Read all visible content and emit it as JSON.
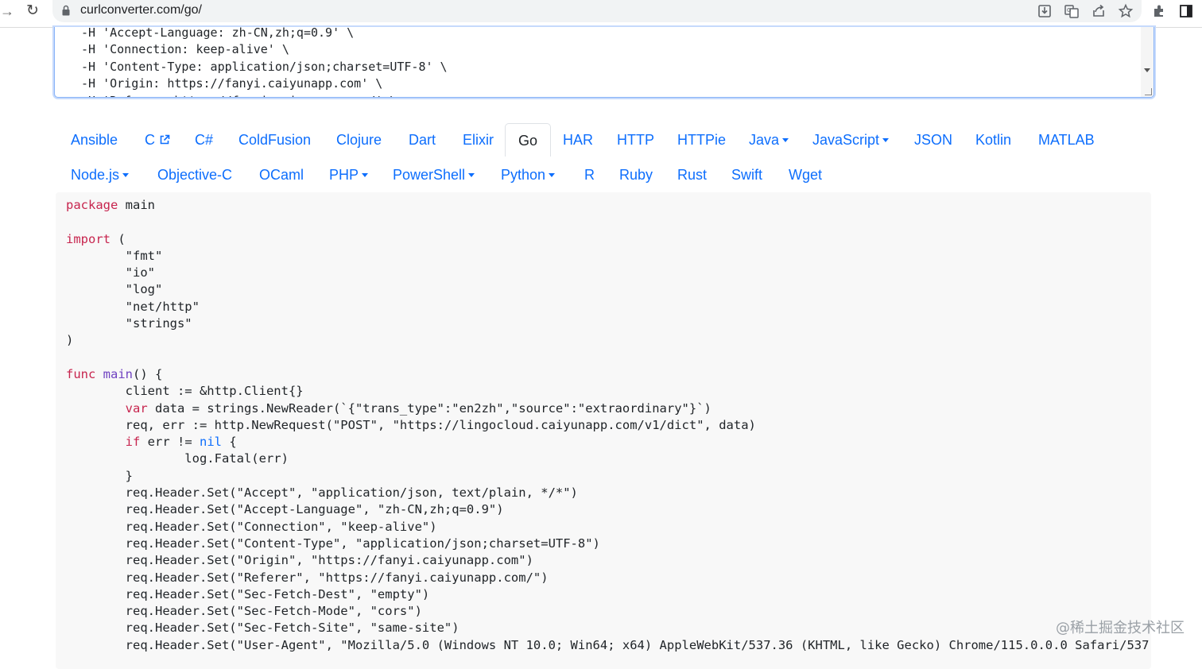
{
  "browser": {
    "url": "curlconverter.com/go/",
    "toolbar_icons": [
      "forward-icon",
      "reload-icon",
      "lock-icon",
      "install-icon",
      "translate-icon",
      "share-icon",
      "bookmark-star-icon",
      "extensions-icon",
      "side-panel-icon"
    ]
  },
  "curl_input": {
    "lines": [
      "-H 'Accept-Language: zh-CN,zh;q=0.9' \\",
      "-H 'Connection: keep-alive' \\",
      "-H 'Content-Type: application/json;charset=UTF-8' \\",
      "-H 'Origin: https://fanyi.caiyunapp.com' \\",
      "-H 'Referer: https://fanyi.caiyunapp.com/' \\"
    ]
  },
  "languages": {
    "row1": [
      {
        "label": "Ansible"
      },
      {
        "label": "C",
        "external": true
      },
      {
        "label": "C#"
      },
      {
        "label": "ColdFusion"
      },
      {
        "label": "Clojure"
      },
      {
        "label": "Dart"
      },
      {
        "label": "Elixir"
      },
      {
        "label": "Go",
        "active": true
      },
      {
        "label": "HAR"
      },
      {
        "label": "HTTP"
      },
      {
        "label": "HTTPie"
      },
      {
        "label": "Java",
        "dropdown": true
      },
      {
        "label": "JavaScript",
        "dropdown": true
      },
      {
        "label": "JSON"
      },
      {
        "label": "Kotlin"
      },
      {
        "label": "MATLAB"
      }
    ],
    "row2": [
      {
        "label": "Node.js",
        "dropdown": true
      },
      {
        "label": "Objective-C"
      },
      {
        "label": "OCaml"
      },
      {
        "label": "PHP",
        "dropdown": true
      },
      {
        "label": "PowerShell",
        "dropdown": true
      },
      {
        "label": "Python",
        "dropdown": true
      },
      {
        "label": "R"
      },
      {
        "label": "Ruby"
      },
      {
        "label": "Rust"
      },
      {
        "label": "Swift"
      },
      {
        "label": "Wget"
      }
    ]
  },
  "code_output": {
    "lines": [
      [
        [
          "kw",
          "package"
        ],
        [
          "",
          "main"
        ]
      ],
      [],
      [
        [
          "kw",
          "import"
        ],
        [
          "",
          " ("
        ]
      ],
      [
        [
          "",
          "        \"fmt\""
        ]
      ],
      [
        [
          "",
          "        \"io\""
        ]
      ],
      [
        [
          "",
          "        \"log\""
        ]
      ],
      [
        [
          "",
          "        \"net/http\""
        ]
      ],
      [
        [
          "",
          "        \"strings\""
        ]
      ],
      [
        [
          "",
          ")"
        ]
      ],
      [],
      [
        [
          "kw",
          "func"
        ],
        [
          "",
          " "
        ],
        [
          "fn",
          "main"
        ],
        [
          "",
          "() {"
        ]
      ],
      [
        [
          "",
          "        client := &http.Client{}"
        ]
      ],
      [
        [
          "",
          "        "
        ],
        [
          "kw",
          "var"
        ],
        [
          "",
          " data = strings.NewReader(`{\"trans_type\":\"en2zh\",\"source\":\"extraordinary\"}`)"
        ]
      ],
      [
        [
          "",
          "        req, err := http.NewRequest(\"POST\", \"https://lingocloud.caiyunapp.com/v1/dict\", data)"
        ]
      ],
      [
        [
          "",
          "        "
        ],
        [
          "kw",
          "if"
        ],
        [
          "",
          " err != "
        ],
        [
          "kwb",
          "nil"
        ],
        [
          "",
          " {"
        ]
      ],
      [
        [
          "",
          "                log.Fatal(err)"
        ]
      ],
      [
        [
          "",
          "        }"
        ]
      ],
      [
        [
          "",
          "        req.Header.Set(\"Accept\", \"application/json, text/plain, */*\")"
        ]
      ],
      [
        [
          "",
          "        req.Header.Set(\"Accept-Language\", \"zh-CN,zh;q=0.9\")"
        ]
      ],
      [
        [
          "",
          "        req.Header.Set(\"Connection\", \"keep-alive\")"
        ]
      ],
      [
        [
          "",
          "        req.Header.Set(\"Content-Type\", \"application/json;charset=UTF-8\")"
        ]
      ],
      [
        [
          "",
          "        req.Header.Set(\"Origin\", \"https://fanyi.caiyunapp.com\")"
        ]
      ],
      [
        [
          "",
          "        req.Header.Set(\"Referer\", \"https://fanyi.caiyunapp.com/\")"
        ]
      ],
      [
        [
          "",
          "        req.Header.Set(\"Sec-Fetch-Dest\", \"empty\")"
        ]
      ],
      [
        [
          "",
          "        req.Header.Set(\"Sec-Fetch-Mode\", \"cors\")"
        ]
      ],
      [
        [
          "",
          "        req.Header.Set(\"Sec-Fetch-Site\", \"same-site\")"
        ]
      ],
      [
        [
          "",
          "        req.Header.Set(\"User-Agent\", \"Mozilla/5.0 (Windows NT 10.0; Win64; x64) AppleWebKit/537.36 (KHTML, like Gecko) Chrome/115.0.0.0 Safari/537"
        ]
      ]
    ]
  },
  "watermark": "@稀土掘金技术社区"
}
